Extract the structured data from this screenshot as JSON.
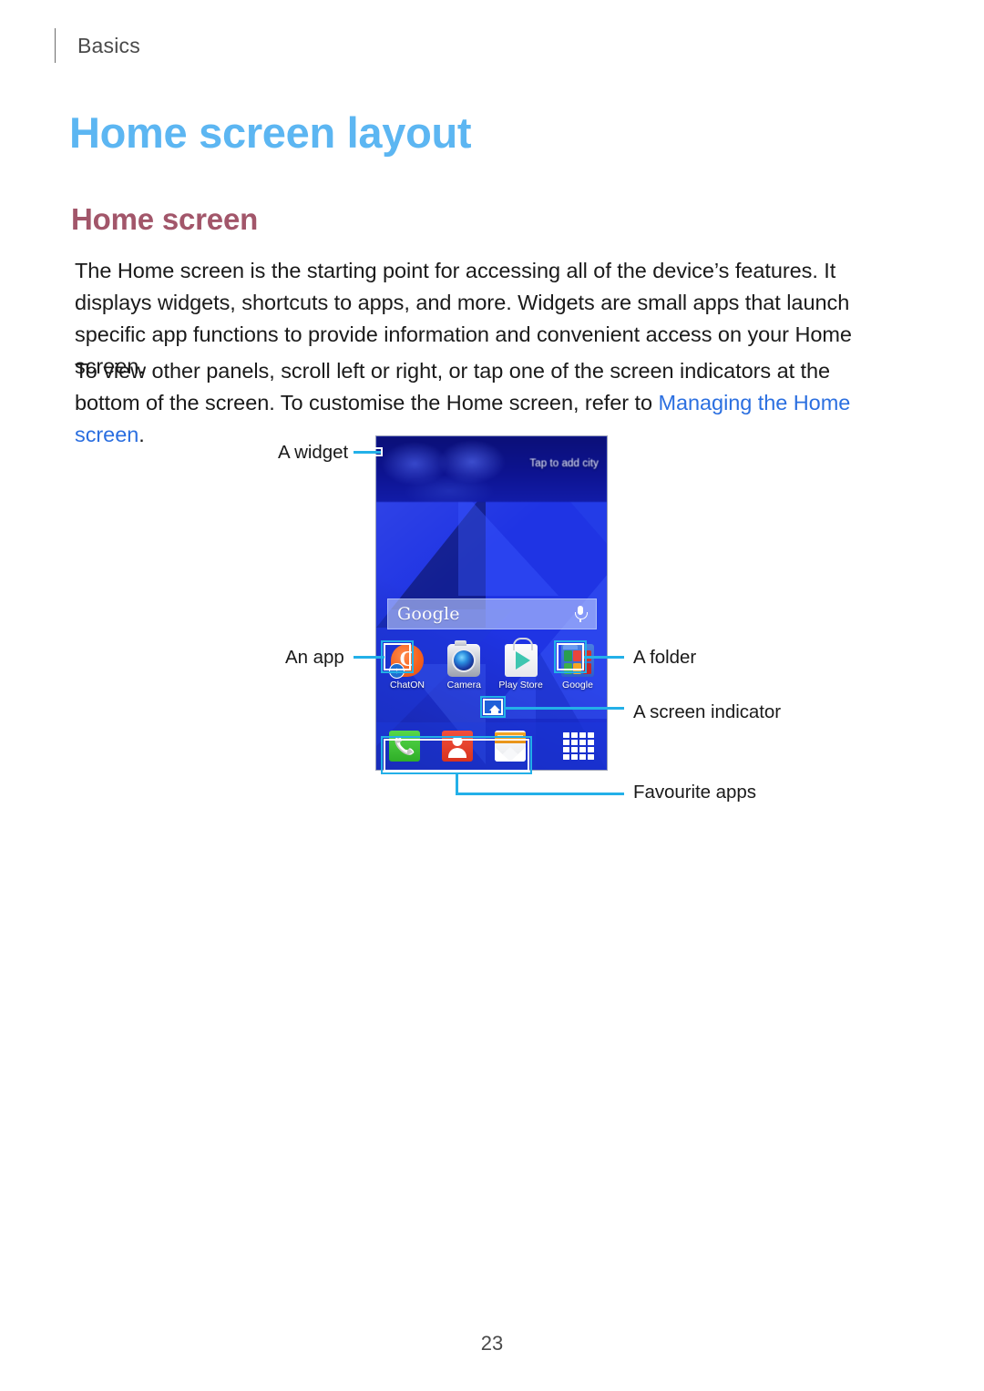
{
  "running_head": {
    "text": "Basics"
  },
  "headings": {
    "h1": "Home screen layout",
    "h2": "Home screen"
  },
  "paragraphs": {
    "p1": "The Home screen is the starting point for accessing all of the device’s features. It displays widgets, shortcuts to apps, and more. Widgets are small apps that launch specific app functions to provide information and convenient access on your Home screen.",
    "p2_before": "To view other panels, scroll left or right, or tap one of the screen indicators at the bottom of the screen. To customise the Home screen, refer to ",
    "p2_link": "Managing the Home screen",
    "p2_after": "."
  },
  "figure": {
    "callouts": {
      "widget": "A widget",
      "app": "An app",
      "folder": "A folder",
      "screen_indicator": "A screen indicator",
      "favourite_apps": "Favourite apps"
    },
    "phone_screen": {
      "widget_text": "Tap to add city",
      "search_bar": {
        "brand": "Google",
        "mic_icon": "microphone-icon"
      },
      "apps": [
        {
          "label": "ChatON",
          "icon": "chaton-icon"
        },
        {
          "label": "Camera",
          "icon": "camera-icon"
        },
        {
          "label": "Play Store",
          "icon": "play-store-icon"
        },
        {
          "label": "Google",
          "icon": "google-folder-icon"
        }
      ],
      "folder_mini_icons": [
        "#2a9d4f",
        "#e8453c",
        "#d0342c",
        "#3fae4a",
        "#f5a623",
        "#c1272d"
      ],
      "indicator_icon": "home-indicator-icon",
      "dock": [
        {
          "label": "Phone",
          "icon": "phone-icon"
        },
        {
          "label": "Contacts",
          "icon": "contacts-icon"
        },
        {
          "label": "Email",
          "icon": "email-icon"
        }
      ],
      "apps_button": "apps-grid-icon"
    }
  },
  "page_number": "23",
  "colors": {
    "h1": "#5cb6f2",
    "h2": "#a2566a",
    "link": "#2b6fe0",
    "callout_line": "#23b0e8",
    "wallpaper": "#1f34e4"
  }
}
